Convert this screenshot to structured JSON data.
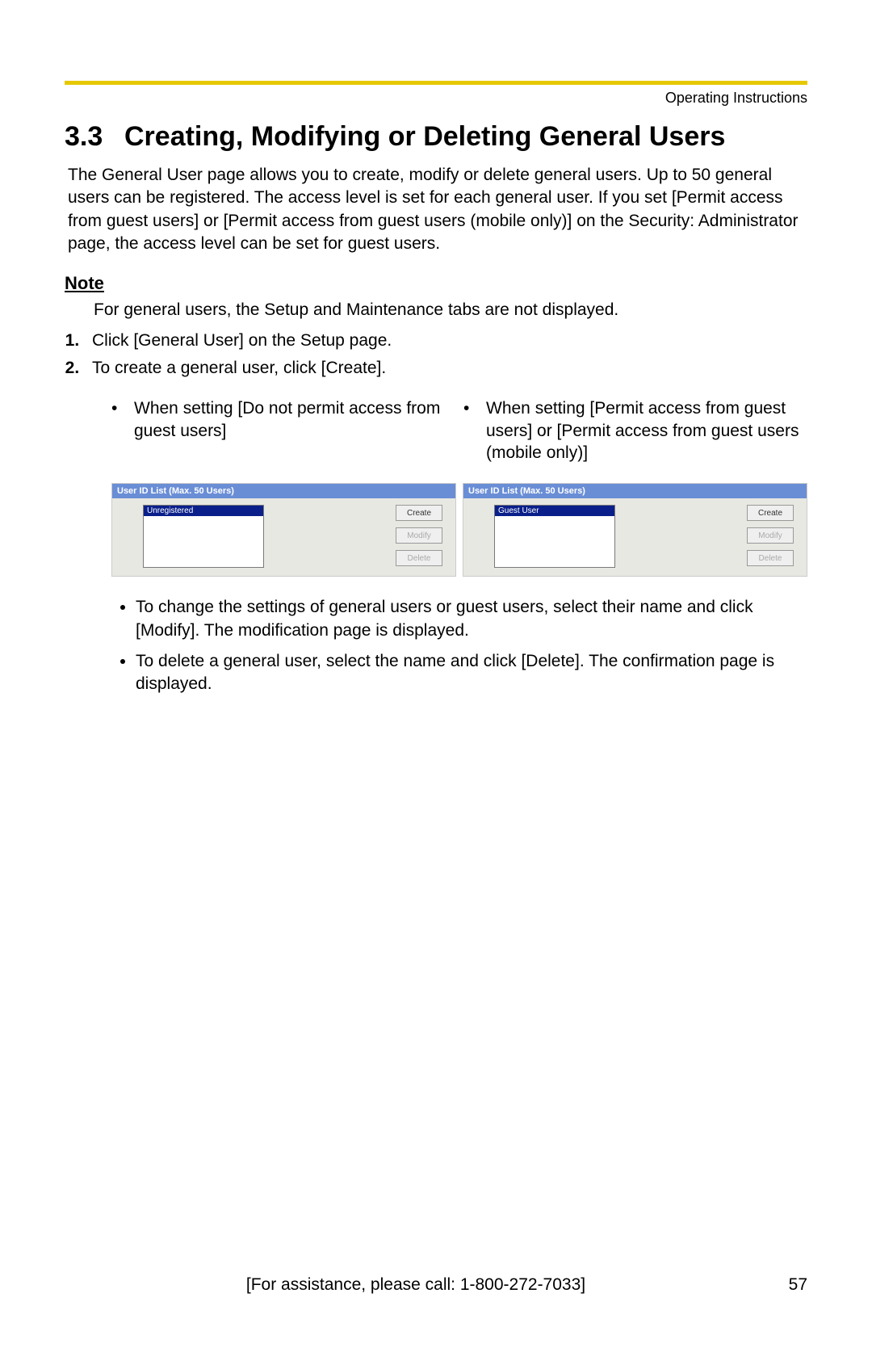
{
  "header_label": "Operating Instructions",
  "section_number": "3.3",
  "section_title": "Creating, Modifying or Deleting General Users",
  "intro": "The General User page allows you to create, modify or delete general users. Up to 50 general users can be registered. The access level is set for each general user. If you set [Permit access from guest users] or [Permit access from guest users (mobile only)] on the Security: Administrator page, the access level can be set for guest users.",
  "note_label": "Note",
  "note_body": "For general users, the Setup and Maintenance tabs are not displayed.",
  "steps": [
    "Click [General User] on the Setup page.",
    "To create a general user, click [Create]."
  ],
  "col_left_heading": "When setting [Do not permit access from guest users]",
  "col_right_heading": "When setting [Permit access from guest users] or [Permit access from guest users (mobile only)]",
  "shot_title": "User ID List (Max. 50 Users)",
  "shot_left_item": "Unregistered",
  "shot_right_item": "Guest User",
  "btn_create": "Create",
  "btn_modify": "Modify",
  "btn_delete": "Delete",
  "sub_bullets": [
    "To change the settings of general users or guest users, select their name and click [Modify]. The modification page is displayed.",
    "To delete a general user, select the name and click [Delete]. The confirmation page is displayed."
  ],
  "footer_center": "[For assistance, please call: 1-800-272-7033]",
  "footer_page": "57"
}
